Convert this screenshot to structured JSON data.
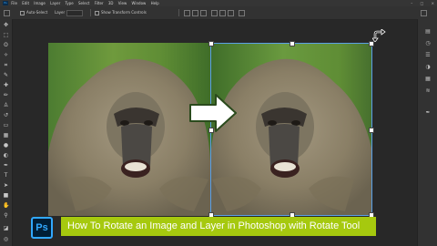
{
  "menubar": {
    "app_badge": "Ps",
    "items": [
      "File",
      "Edit",
      "Image",
      "Layer",
      "Type",
      "Select",
      "Filter",
      "3D",
      "View",
      "Window",
      "Help"
    ],
    "window_controls": [
      "–",
      "□",
      "×"
    ]
  },
  "options": {
    "auto_select_label": "Auto-Select",
    "layer_value": "Layer",
    "show_transform_label": "Show Transform Controls"
  },
  "toolbar": {
    "icons": [
      "move-tool-icon",
      "marquee-tool-icon",
      "lasso-tool-icon",
      "magic-wand-icon",
      "crop-tool-icon",
      "eyedropper-icon",
      "healing-brush-icon",
      "brush-tool-icon",
      "clone-stamp-icon",
      "history-brush-icon",
      "eraser-icon",
      "gradient-icon",
      "blur-icon",
      "dodge-icon",
      "pen-tool-icon",
      "type-tool-icon",
      "path-selection-icon",
      "shape-tool-icon",
      "hand-tool-icon",
      "zoom-tool-icon"
    ]
  },
  "right_panel": {
    "icons": [
      "layers-icon",
      "history-icon",
      "properties-icon",
      "adjustments-icon",
      "swatches-icon",
      "channels-icon",
      "paths-icon"
    ]
  },
  "canvas": {
    "left_image": "baboon-photo",
    "right_image": "baboon-photo-mirrored",
    "arrow_icon": "right-arrow-icon",
    "cursor_icon": "rotate-cursor-icon"
  },
  "caption": {
    "logo_text": "Ps",
    "text": "How To Rotate an Image and Layer in Photoshop with Rotate Tool",
    "bar_color": "#a6c90e",
    "logo_color": "#31a8ff"
  }
}
